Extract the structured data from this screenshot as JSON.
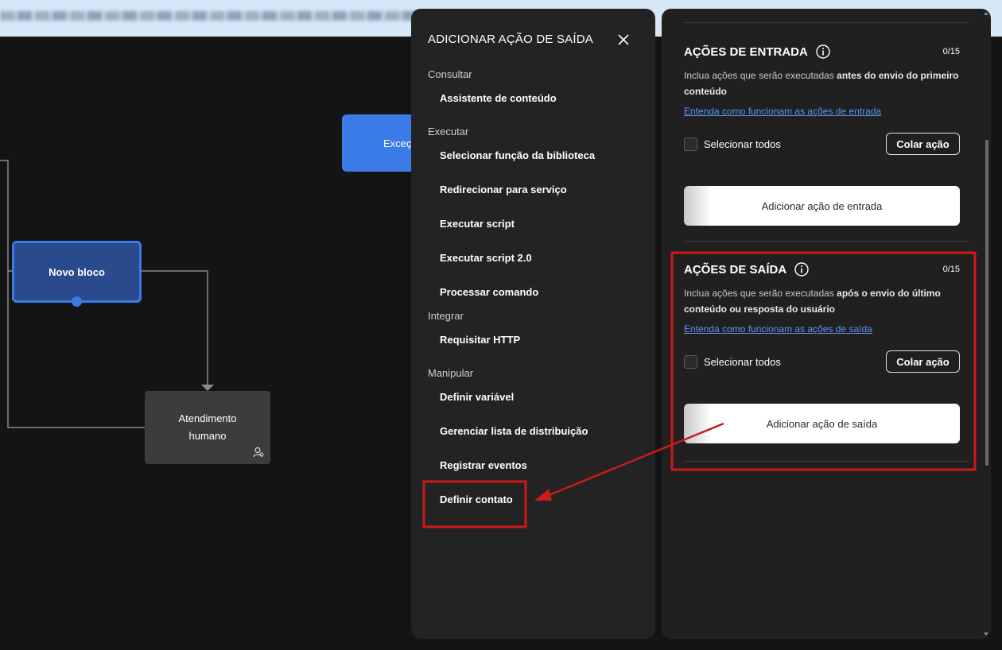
{
  "canvas": {
    "blocks": {
      "novo_bloco": "Novo bloco",
      "atendimento": "Atendimento humano",
      "excecao": "Exceção"
    }
  },
  "menu": {
    "title": "ADICIONAR AÇÃO DE SAÍDA",
    "close_icon": "close-icon",
    "groups": {
      "consultar": "Consultar",
      "executar": "Executar",
      "integrar": "Integrar",
      "manipular": "Manipular"
    },
    "items": {
      "assistente": "Assistente de conteúdo",
      "selecionar_funcao": "Selecionar função da biblioteca",
      "redirecionar": "Redirecionar para serviço",
      "executar_script": "Executar script",
      "executar_script2": "Executar script 2.0",
      "processar": "Processar comando",
      "requisitar_http": "Requisitar HTTP",
      "definir_variavel": "Definir variável",
      "gerenciar_lista": "Gerenciar lista de distribuição",
      "registrar_eventos": "Registrar eventos",
      "definir_contato": "Definir contato"
    }
  },
  "panel": {
    "entrada": {
      "title": "AÇÕES DE ENTRADA",
      "counter": "0/15",
      "desc_prefix": "Inclua ações que serão executadas ",
      "desc_bold": "antes do envio do primeiro conteúdo",
      "link": "Entenda como funcionam as ações de entrada",
      "select_all": "Selecionar todos",
      "paste": "Colar ação",
      "add": "Adicionar ação de entrada"
    },
    "saida": {
      "title": "AÇÕES DE SAÍDA",
      "counter": "0/15",
      "desc_prefix": "Inclua ações que serão executadas ",
      "desc_bold": "após o envio do último conteúdo ou resposta do usuário",
      "link": "Entenda como funcionam as ações de saída",
      "select_all": "Selecionar todos",
      "paste": "Colar ação",
      "add": "Adicionar ação de saída"
    }
  },
  "colors": {
    "annotation": "#cc1a1a",
    "accent_blue": "#3b7be8",
    "link": "#5b93f0"
  }
}
